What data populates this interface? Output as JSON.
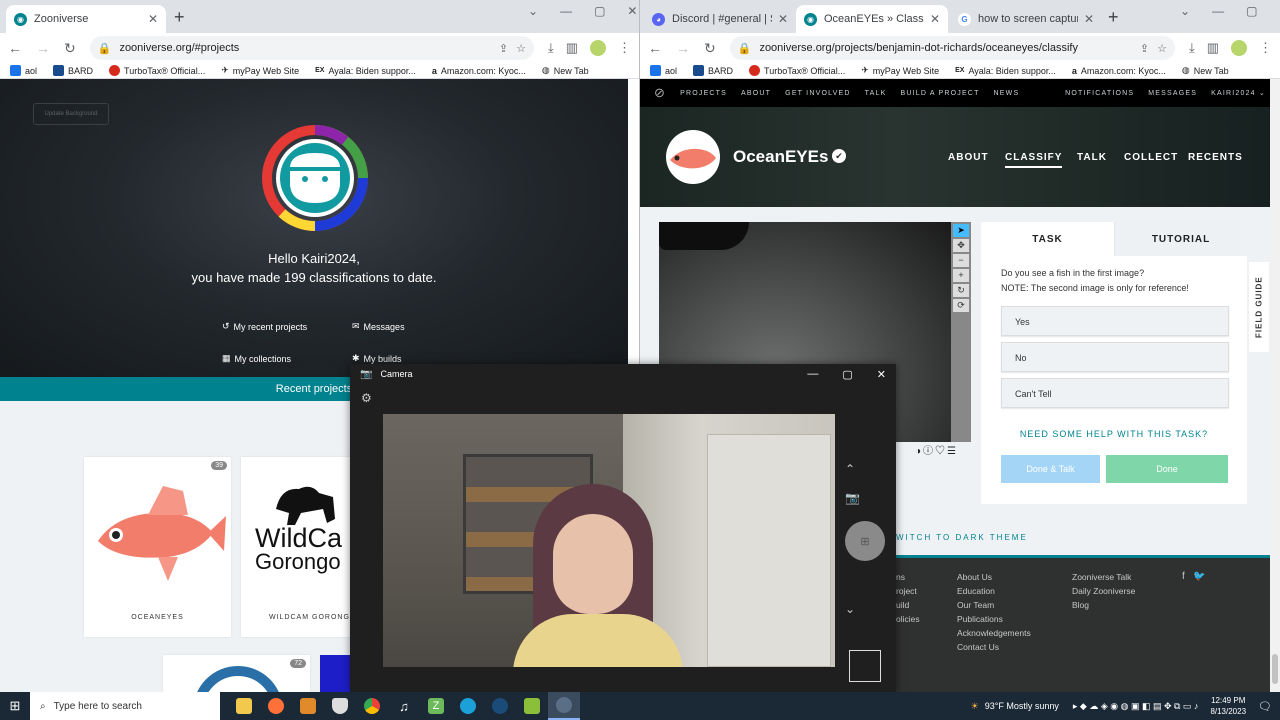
{
  "left_browser": {
    "tabs": [
      {
        "title": "Zooniverse",
        "active": true
      }
    ],
    "url": "zooniverse.org/#projects",
    "bookmarks": [
      "aol",
      "BARD",
      "TurboTax® Official...",
      "myPay Web Site",
      "Ayala: Biden suppor...",
      "Amazon.com: Kyoc...",
      "New Tab"
    ]
  },
  "right_browser": {
    "tabs": [
      {
        "title": "Discord | #general | Study Hall",
        "active": false
      },
      {
        "title": "OceanEYEs » Classify — Zooniv...",
        "active": true
      },
      {
        "title": "how to screen capture on wind...",
        "active": false
      }
    ],
    "url": "zooniverse.org/projects/benjamin-dot-richards/oceaneyes/classify",
    "bookmarks": [
      "aol",
      "BARD",
      "TurboTax® Official...",
      "myPay Web Site",
      "Ayala: Biden suppor...",
      "Amazon.com: Kyoc...",
      "New Tab"
    ]
  },
  "home": {
    "update_background": "Update Background",
    "greeting": "Hello Kairi2024,",
    "subgreeting": "you have made 199 classifications to date.",
    "links": [
      "My recent projects",
      "Messages",
      "My collections",
      "My builds"
    ],
    "recent_projects": "Recent projects",
    "cards": [
      {
        "label": "OCEANEYES",
        "count": "39"
      },
      {
        "label": "WILDCAM GORONGOSA",
        "count": ""
      },
      {
        "label": "",
        "count": "72"
      }
    ],
    "wildcam_line1": "WildCa",
    "wildcam_line2": "Gorongo"
  },
  "zooniverse_nav": [
    "PROJECTS",
    "ABOUT",
    "GET INVOLVED",
    "TALK",
    "BUILD A PROJECT",
    "NEWS",
    "NOTIFICATIONS",
    "MESSAGES",
    "KAIRI2024"
  ],
  "project": {
    "title": "OceanEYEs",
    "nav": [
      "ABOUT",
      "CLASSIFY",
      "TALK",
      "COLLECT",
      "RECENTS"
    ]
  },
  "task_panel": {
    "tabs": [
      "TASK",
      "TUTORIAL"
    ],
    "question_line1": "Do you see a fish in the first image?",
    "question_line2": "NOTE: The second image is only for reference!",
    "answers": [
      "Yes",
      "No",
      "Can't Tell"
    ],
    "help": "NEED SOME HELP WITH THIS TASK?",
    "done_talk": "Done & Talk",
    "done": "Done",
    "field_guide": "FIELD GUIDE"
  },
  "dark_theme": "WITCH TO DARK THEME",
  "footer": {
    "col1": [
      "ns",
      "roject",
      "uild",
      "olicies"
    ],
    "col2": [
      "About Us",
      "Education",
      "Our Team",
      "Publications",
      "Acknowledgements",
      "Contact Us"
    ],
    "col3": [
      "Zooniverse Talk",
      "Daily Zooniverse",
      "Blog"
    ]
  },
  "camera": {
    "title": "Camera"
  },
  "taskbar": {
    "search_placeholder": "Type here to search",
    "weather": "93°F  Mostly sunny",
    "time": "12:49 PM",
    "date": "8/13/2023"
  },
  "colors": {
    "teal": "#00838f",
    "done_talk": "#a5d5f6",
    "done": "#7fd6a8"
  }
}
